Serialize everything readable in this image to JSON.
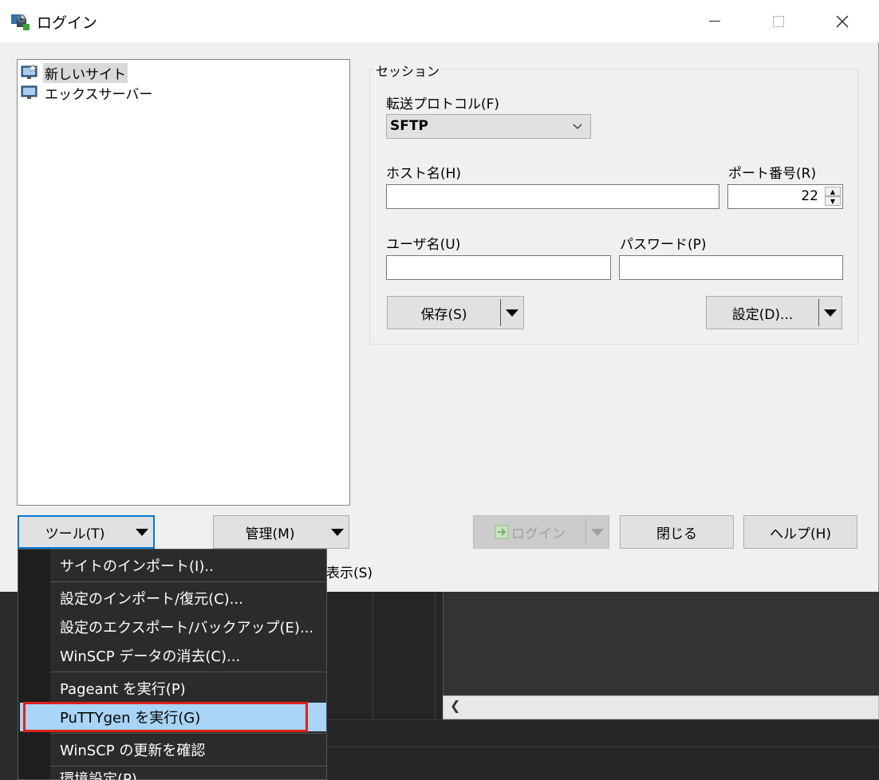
{
  "window": {
    "title": "ログイン"
  },
  "sites": [
    {
      "label": "新しいサイト",
      "selected": true
    },
    {
      "label": "エックスサーバー",
      "selected": false
    }
  ],
  "session": {
    "legend": "セッション",
    "protocol_label": "転送プロトコル(F)",
    "protocol_value": "SFTP",
    "host_label": "ホスト名(H)",
    "host_value": "",
    "port_label": "ポート番号(R)",
    "port_value": "22",
    "user_label": "ユーザ名(U)",
    "user_value": "",
    "password_label": "パスワード(P)",
    "password_value": "",
    "save_label": "保存(S)",
    "settings_label": "設定(D)..."
  },
  "buttons": {
    "tools": "ツール(T)",
    "manage": "管理(M)",
    "login": "ログイン",
    "close": "閉じる",
    "help": "ヘルプ(H)",
    "show": "表示(S)"
  },
  "menu": {
    "items": [
      "サイトのインポート(I)..",
      "設定のインポート/復元(C)...",
      "設定のエクスポート/バックアップ(E)...",
      "WinSCP データの消去(C)...",
      "Pageant を実行(P)",
      "PuTTYgen を実行(G)",
      "WinSCP の更新を確認",
      "環境設定(P)..."
    ],
    "highlighted_index": 5
  },
  "colors": {
    "highlight_border": "#e0201c",
    "menu_hover": "#a8d4f5",
    "focus_border": "#0078d7"
  },
  "icons": [
    "app-icon",
    "minimize-icon",
    "maximize-icon",
    "close-icon",
    "monitor-new-site-icon",
    "monitor-icon",
    "chevron-down-icon",
    "spin-up-icon",
    "spin-down-icon",
    "dropdown-arrow-icon",
    "login-icon",
    "scroll-left-icon"
  ]
}
